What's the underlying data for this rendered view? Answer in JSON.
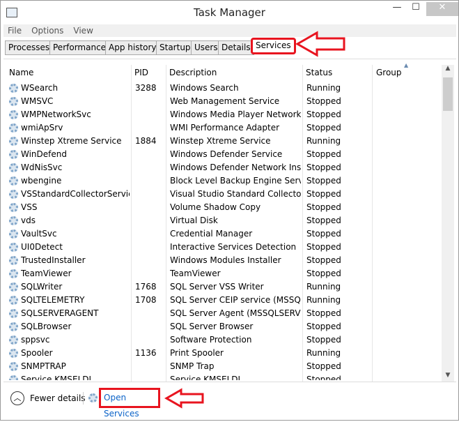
{
  "window": {
    "title": "Task Manager",
    "minimize": "—",
    "maximize": "☐",
    "close": "✕"
  },
  "menu": [
    "File",
    "Options",
    "View"
  ],
  "tabs": [
    "Processes",
    "Performance",
    "App history",
    "Startup",
    "Users",
    "Details",
    "Services"
  ],
  "active_tab": "Services",
  "columns": {
    "name": "Name",
    "pid": "PID",
    "description": "Description",
    "status": "Status",
    "group": "Group"
  },
  "rows": [
    [
      "WSearch",
      "3288",
      "Windows Search",
      "Running"
    ],
    [
      "WMSVC",
      "",
      "Web Management Service",
      "Stopped"
    ],
    [
      "WMPNetworkSvc",
      "",
      "Windows Media Player Network ...",
      "Stopped"
    ],
    [
      "wmiApSrv",
      "",
      "WMI Performance Adapter",
      "Stopped"
    ],
    [
      "Winstep Xtreme Service",
      "1884",
      "Winstep Xtreme Service",
      "Running"
    ],
    [
      "WinDefend",
      "",
      "Windows Defender Service",
      "Stopped"
    ],
    [
      "WdNisSvc",
      "",
      "Windows Defender Network Insp...",
      "Stopped"
    ],
    [
      "wbengine",
      "",
      "Block Level Backup Engine Service",
      "Stopped"
    ],
    [
      "VSStandardCollectorService...",
      "",
      "Visual Studio Standard Collector ...",
      "Stopped"
    ],
    [
      "VSS",
      "",
      "Volume Shadow Copy",
      "Stopped"
    ],
    [
      "vds",
      "",
      "Virtual Disk",
      "Stopped"
    ],
    [
      "VaultSvc",
      "",
      "Credential Manager",
      "Stopped"
    ],
    [
      "UI0Detect",
      "",
      "Interactive Services Detection",
      "Stopped"
    ],
    [
      "TrustedInstaller",
      "",
      "Windows Modules Installer",
      "Stopped"
    ],
    [
      "TeamViewer",
      "",
      "TeamViewer",
      "Stopped"
    ],
    [
      "SQLWriter",
      "1768",
      "SQL Server VSS Writer",
      "Running"
    ],
    [
      "SQLTELEMETRY",
      "1708",
      "SQL Server CEIP service (MSSQLS...",
      "Running"
    ],
    [
      "SQLSERVERAGENT",
      "",
      "SQL Server Agent (MSSQLSERVER)",
      "Stopped"
    ],
    [
      "SQLBrowser",
      "",
      "SQL Server Browser",
      "Stopped"
    ],
    [
      "sppsvc",
      "",
      "Software Protection",
      "Stopped"
    ],
    [
      "Spooler",
      "1136",
      "Print Spooler",
      "Running"
    ],
    [
      "SNMPTRAP",
      "",
      "SNMP Trap",
      "Stopped"
    ],
    [
      "Service KMSELDI",
      "",
      "Service KMSELDI",
      "Stopped"
    ]
  ],
  "footer": {
    "fewer_details": "Fewer details",
    "open_services": "Open Services"
  },
  "colors": {
    "highlight": "#e8141f",
    "link": "#0b63c8"
  }
}
